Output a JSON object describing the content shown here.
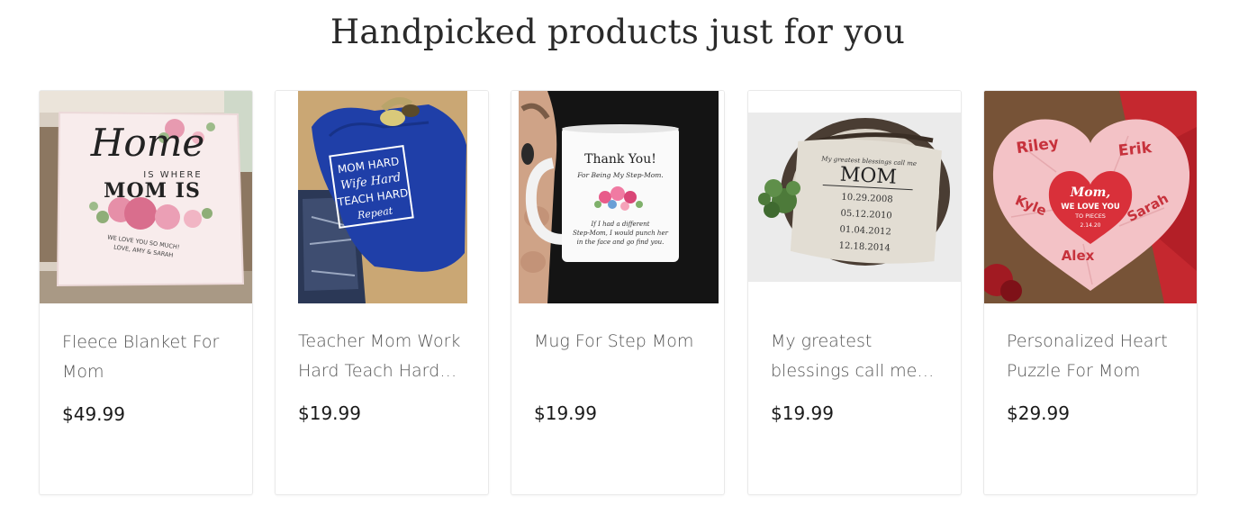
{
  "section": {
    "title": "Handpicked products just for you"
  },
  "products": [
    {
      "title": "Fleece Blanket For Mom",
      "price": "$49.99",
      "image_text": {
        "line1": "Home",
        "line2": "IS WHERE",
        "line3": "MOM IS",
        "line4": "WE LOVE YOU SO MUCH!",
        "line5": "LOVE, AMY & SARAH"
      }
    },
    {
      "title": "Teacher Mom Work Hard Teach Hard Repeat T-Shirt",
      "price": "$19.99",
      "image_text": {
        "line1": "MOM HARD",
        "line2": "Wife Hard",
        "line3": "TEACH HARD",
        "line4": "Repeat"
      }
    },
    {
      "title": "Mug For Step Mom",
      "price": "$19.99",
      "image_text": {
        "line1": "Thank You!",
        "line2": "For Being My Step-Mom.",
        "line3": "If I had a different",
        "line4": "Step-Mom, I would punch her",
        "line5": "in the face and go find you."
      }
    },
    {
      "title": "My greatest blessings call me Mom Pillow",
      "price": "$19.99",
      "image_text": {
        "line1": "My greatest blessings call me",
        "line2": "MOM",
        "dates": [
          "10.29.2008",
          "05.12.2010",
          "01.04.2012",
          "12.18.2014"
        ]
      }
    },
    {
      "title": "Personalized Heart Puzzle For Mom",
      "price": "$29.99",
      "image_text": {
        "names": [
          "Riley",
          "Erik",
          "Kyle",
          "Sarah",
          "Alex"
        ],
        "center1": "Mom,",
        "center2": "WE LOVE YOU",
        "center3": "TO PIECES",
        "center4": "2.14.20"
      }
    }
  ],
  "colors": {
    "title": "#2a2a2a",
    "product_title": "#555555",
    "price": "#1a1a1a",
    "card_border": "#e9e9e9",
    "shirt_blue": "#1f3fa8",
    "puzzle_pink": "#f3c2c6",
    "puzzle_red": "#c5282f"
  }
}
